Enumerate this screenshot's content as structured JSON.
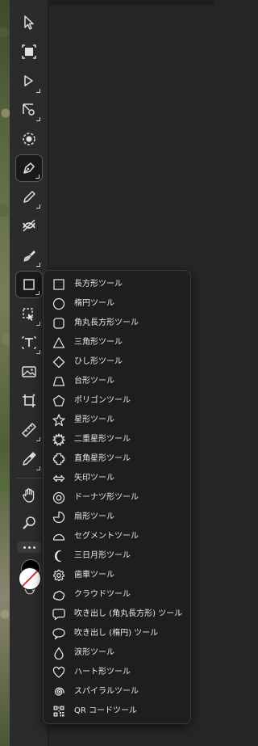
{
  "toolbar": {
    "tools": [
      {
        "name": "move-tool",
        "icon": "arrow-cursor-icon",
        "selected": false
      },
      {
        "name": "artboard-tool",
        "icon": "artboard-icon",
        "selected": false
      },
      {
        "name": "direct-selection-tool",
        "icon": "hollow-arrow-icon",
        "selected": false
      },
      {
        "name": "anchor-point-tool",
        "icon": "anchor-point-icon",
        "selected": false
      },
      {
        "name": "lasso-tool",
        "icon": "lasso-circle-icon",
        "selected": false
      },
      {
        "name": "pen-tool",
        "icon": "pen-nib-icon",
        "selected": true
      },
      {
        "name": "pencil-tool",
        "icon": "pencil-icon",
        "selected": false
      },
      {
        "name": "blend-tool",
        "icon": "blend-icon",
        "selected": false
      },
      {
        "name": "brush-tool",
        "icon": "paintbrush-icon",
        "selected": false
      },
      {
        "name": "shape-tool",
        "icon": "rectangle-icon",
        "selected": true
      },
      {
        "name": "shape-builder-tool",
        "icon": "shape-builder-icon",
        "selected": false
      },
      {
        "name": "type-tool",
        "icon": "text-frame-icon",
        "selected": false
      },
      {
        "name": "image-tool",
        "icon": "image-icon",
        "selected": false
      },
      {
        "name": "crop-tool",
        "icon": "crop-icon",
        "selected": false
      },
      {
        "name": "ruler-tool",
        "icon": "ruler-icon",
        "selected": false
      },
      {
        "name": "eyedropper-tool",
        "icon": "eyedropper-icon",
        "selected": false
      },
      {
        "name": "hand-tool",
        "icon": "hand-icon",
        "selected": false
      },
      {
        "name": "zoom-tool",
        "icon": "magnifier-icon",
        "selected": false
      }
    ],
    "fill_color": "#000000",
    "stroke_color": "#ffffff",
    "none_indicator_color": "#e0302a"
  },
  "flyout": {
    "items": [
      {
        "icon": "rectangle-icon",
        "label": "長方形ツール"
      },
      {
        "icon": "ellipse-icon",
        "label": "楕円ツール"
      },
      {
        "icon": "rounded-rectangle-icon",
        "label": "角丸長方形ツール"
      },
      {
        "icon": "triangle-icon",
        "label": "三角形ツール"
      },
      {
        "icon": "diamond-icon",
        "label": "ひし形ツール"
      },
      {
        "icon": "trapezoid-icon",
        "label": "台形ツール"
      },
      {
        "icon": "pentagon-icon",
        "label": "ポリゴンツール"
      },
      {
        "icon": "star-icon",
        "label": "星形ツール"
      },
      {
        "icon": "double-star-icon",
        "label": "二重星形ツール"
      },
      {
        "icon": "square-star-icon",
        "label": "直角星形ツール"
      },
      {
        "icon": "double-arrow-icon",
        "label": "矢印ツール"
      },
      {
        "icon": "donut-icon",
        "label": "ドーナツ形ツール"
      },
      {
        "icon": "pie-icon",
        "label": "扇形ツール"
      },
      {
        "icon": "segment-icon",
        "label": "セグメントツール"
      },
      {
        "icon": "crescent-icon",
        "label": "三日月形ツール"
      },
      {
        "icon": "gear-icon",
        "label": "歯車ツール"
      },
      {
        "icon": "cloud-icon",
        "label": "クラウドツール"
      },
      {
        "icon": "speech-bubble-rect-icon",
        "label": "吹き出し (角丸長方形) ツール"
      },
      {
        "icon": "speech-bubble-ellipse-icon",
        "label": "吹き出し (楕円) ツール"
      },
      {
        "icon": "teardrop-icon",
        "label": "涙形ツール"
      },
      {
        "icon": "heart-icon",
        "label": "ハート形ツール"
      },
      {
        "icon": "spiral-icon",
        "label": "スパイラルツール"
      },
      {
        "icon": "qr-code-icon",
        "label": "QR コードツール"
      }
    ]
  }
}
